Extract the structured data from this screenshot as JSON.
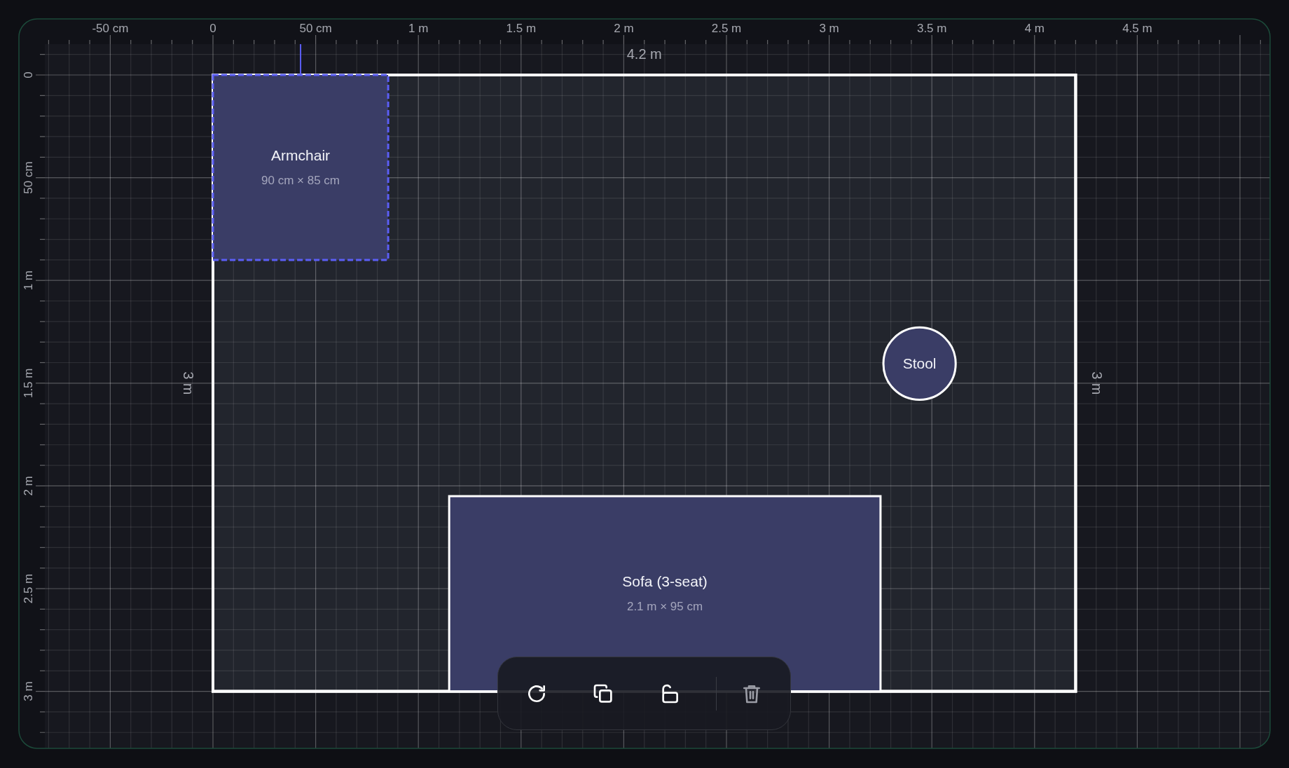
{
  "ruler_top": {
    "labels": [
      "-50 cm",
      "0",
      "50 cm",
      "1 m",
      "1.5 m",
      "2 m",
      "2.5 m",
      "3 m",
      "3.5 m",
      "4 m",
      "4.5 m"
    ]
  },
  "ruler_left": {
    "labels": [
      "0",
      "50 cm",
      "1 m",
      "1.5 m",
      "2 m",
      "2.5 m",
      "3 m"
    ]
  },
  "room": {
    "width_label": "4.2 m",
    "depth_label": "3 m",
    "depth_label_right": "3 m"
  },
  "furniture": [
    {
      "kind": "rect",
      "name": "Armchair",
      "size": "90 cm × 85 cm",
      "selected": true
    },
    {
      "kind": "circle",
      "name": "Stool",
      "selected": false
    },
    {
      "kind": "rect",
      "name": "Sofa (3-seat)",
      "size": "2.1 m × 95 cm",
      "selected": false
    }
  ],
  "toolbar": {
    "locked": false
  }
}
